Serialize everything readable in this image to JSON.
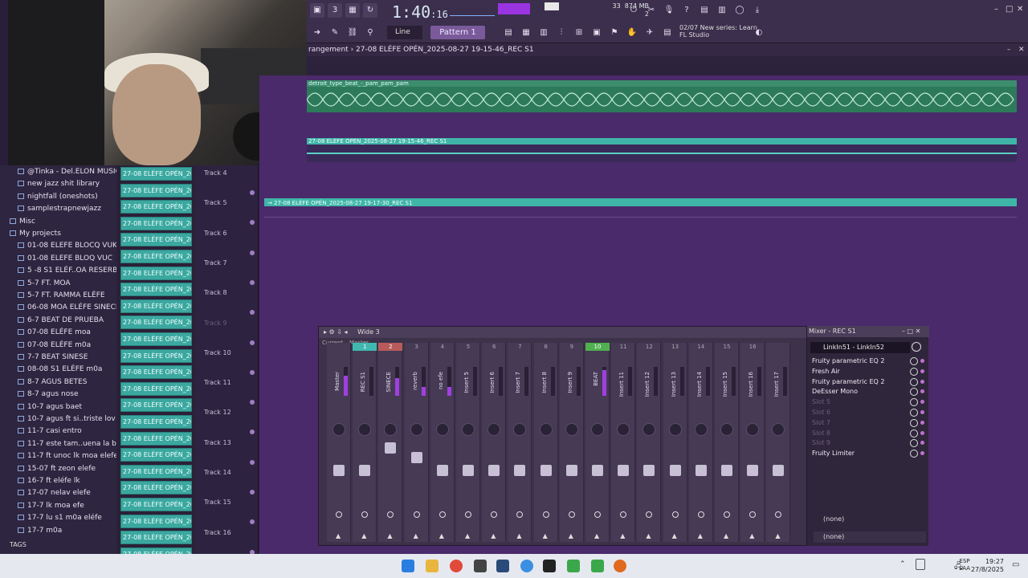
{
  "toolbar": {
    "clock": "1:40",
    "clock_sub": ":16",
    "cpu": "33",
    "memory": "874 MB",
    "memory_sub": "2",
    "snap": "Line",
    "pattern": "Pattern 1",
    "news_date": "02/07",
    "news_line1": "New series: Learn",
    "news_line2": "FL Studio"
  },
  "playlist": {
    "title": "rangement › 27-08 ELÉFE OPÉN_2025-08-27 19-15-46_REC S1",
    "clip1": "detroit_type_beat_-_pam_pam_pam",
    "clip2": "27-08 ELÉFE OPÉN_2025-08-27 19-15-46_REC S1",
    "clip3": "→ 27-08 ELÉFE OPÉN_2025-08-27 19-17-30_REC S1"
  },
  "tracks": [
    "Track 4",
    "Track 5",
    "Track 6",
    "Track 7",
    "Track 8",
    "Track 9",
    "Track 10",
    "Track 11",
    "Track 12",
    "Track 13",
    "Track 14",
    "Track 15",
    "Track 16"
  ],
  "browser": {
    "items": [
      {
        "label": "@Tinka - Del.ELON MUSIC_",
        "folder": false
      },
      {
        "label": "new jazz shit library",
        "folder": false
      },
      {
        "label": "nightfall (oneshots)",
        "folder": false
      },
      {
        "label": "samplestrapnewjazz",
        "folder": false
      },
      {
        "label": "Misc",
        "folder": true
      },
      {
        "label": "My projects",
        "folder": true
      },
      {
        "label": "01-08 ELEFE BLOCQ VUK",
        "folder": false
      },
      {
        "label": "01-08 ELEFE BLOQ VUC",
        "folder": false
      },
      {
        "label": "5 -8 S1 ELÉF..OA RESERBADO",
        "folder": false
      },
      {
        "label": "5-7 FT. MOA",
        "folder": false
      },
      {
        "label": "5-7 FT. RAMMA ELÉFE",
        "folder": false
      },
      {
        "label": "06-08 MOA ELÉFE SINECE",
        "folder": false
      },
      {
        "label": "6-7 BEAT DE PRUEBA",
        "folder": false
      },
      {
        "label": "07-08  ELÉFE moa",
        "folder": false
      },
      {
        "label": "07-08 ELÉFE m0a",
        "folder": false
      },
      {
        "label": "7-7 BEAT SINESE",
        "folder": false
      },
      {
        "label": "08-08 S1 ELÉFE m0a",
        "folder": false
      },
      {
        "label": "8-7 AGUS BETES",
        "folder": false
      },
      {
        "label": "8-7 agus nose",
        "folder": false
      },
      {
        "label": "10-7 agus baet",
        "folder": false
      },
      {
        "label": "10-7 agus ft si..triste lov you",
        "folder": false
      },
      {
        "label": "11-7 casi entro",
        "folder": false
      },
      {
        "label": "11-7 este tam..uena la base",
        "folder": false
      },
      {
        "label": "11-7 ft unoc lk moa elefe",
        "folder": false
      },
      {
        "label": "15-07 ft zeon elefe",
        "folder": false
      },
      {
        "label": "16-7 ft eléfe lk",
        "folder": false
      },
      {
        "label": "17-07 nelav elefe",
        "folder": false
      },
      {
        "label": "17-7 lk moa efe",
        "folder": false
      },
      {
        "label": "17-7 lu s1 m0a eléfe",
        "folder": false
      },
      {
        "label": "17-7 m0a",
        "folder": false
      }
    ],
    "tags": "TAGS"
  },
  "clip_label": "27-08 ELÉFE OPÉN_2025...",
  "clip_count": 24,
  "mixer": {
    "title": "Wide 3",
    "panel_title": "Mixer - REC S1",
    "header_current": "Current",
    "header_master": "Master",
    "channels": [
      {
        "num": "",
        "name": "Master",
        "meter": 0.7,
        "fader": 0.35,
        "state": ""
      },
      {
        "num": "1",
        "name": "REC S1",
        "meter": 0.0,
        "fader": 0.35,
        "state": "teal"
      },
      {
        "num": "2",
        "name": "SINECE",
        "meter": 0.6,
        "fader": 0.7,
        "state": "red"
      },
      {
        "num": "3",
        "name": "reverb",
        "meter": 0.3,
        "fader": 0.55,
        "state": ""
      },
      {
        "num": "4",
        "name": "no efe",
        "meter": 0.3,
        "fader": 0.35,
        "state": ""
      },
      {
        "num": "5",
        "name": "Insert 5",
        "meter": 0.0,
        "fader": 0.35,
        "state": ""
      },
      {
        "num": "6",
        "name": "Insert 6",
        "meter": 0.0,
        "fader": 0.35,
        "state": ""
      },
      {
        "num": "7",
        "name": "Insert 7",
        "meter": 0.0,
        "fader": 0.35,
        "state": ""
      },
      {
        "num": "8",
        "name": "Insert 8",
        "meter": 0.0,
        "fader": 0.35,
        "state": ""
      },
      {
        "num": "9",
        "name": "Insert 9",
        "meter": 0.0,
        "fader": 0.35,
        "state": ""
      },
      {
        "num": "10",
        "name": "BEAT",
        "meter": 0.9,
        "fader": 0.35,
        "state": "green"
      },
      {
        "num": "11",
        "name": "Insert 11",
        "meter": 0.0,
        "fader": 0.35,
        "state": ""
      },
      {
        "num": "12",
        "name": "Insert 12",
        "meter": 0.0,
        "fader": 0.35,
        "state": ""
      },
      {
        "num": "13",
        "name": "Insert 13",
        "meter": 0.0,
        "fader": 0.35,
        "state": ""
      },
      {
        "num": "14",
        "name": "Insert 14",
        "meter": 0.0,
        "fader": 0.35,
        "state": ""
      },
      {
        "num": "15",
        "name": "Insert 15",
        "meter": 0.0,
        "fader": 0.35,
        "state": ""
      },
      {
        "num": "16",
        "name": "Insert 16",
        "meter": 0.0,
        "fader": 0.35,
        "state": ""
      },
      {
        "num": "",
        "name": "Insert 17",
        "meter": 0.0,
        "fader": 0.35,
        "state": ""
      }
    ],
    "input": "LinkIn51 - LinkIn52",
    "slots": [
      {
        "label": "Fruity parametric EQ 2",
        "empty": false
      },
      {
        "label": "Fresh Air",
        "empty": false
      },
      {
        "label": "Fruity parametric EQ 2",
        "empty": false
      },
      {
        "label": "DeEsser Mono",
        "empty": false
      },
      {
        "label": "Slot 5",
        "empty": true
      },
      {
        "label": "Slot 6",
        "empty": true
      },
      {
        "label": "Slot 7",
        "empty": true
      },
      {
        "label": "Slot 8",
        "empty": true
      },
      {
        "label": "Slot 9",
        "empty": true
      },
      {
        "label": "Fruity Limiter",
        "empty": false
      }
    ],
    "send1": "(none)",
    "send2": "(none)"
  },
  "taskbar": {
    "lang1": "ESP",
    "lang2": "LAA",
    "time": "19:27",
    "date": "27/8/2025"
  }
}
